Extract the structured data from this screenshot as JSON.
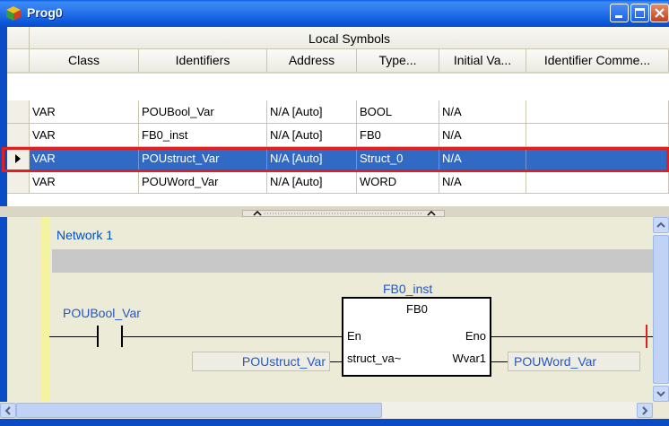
{
  "window": {
    "title": "Prog0"
  },
  "symbols": {
    "group_header": "Local Symbols",
    "columns": [
      "Class",
      "Identifiers",
      "Address",
      "Type...",
      "Initial Va...",
      "Identifier Comme..."
    ],
    "rows": [
      {
        "cells": [
          "VAR",
          "POUBool_Var",
          "N/A [Auto]",
          "BOOL",
          "N/A",
          ""
        ],
        "selected": false
      },
      {
        "cells": [
          "VAR",
          "FB0_inst",
          "N/A [Auto]",
          "FB0",
          "N/A",
          ""
        ],
        "selected": false
      },
      {
        "cells": [
          "VAR",
          "POUstruct_Var",
          "N/A [Auto]",
          "Struct_0",
          "N/A",
          ""
        ],
        "selected": true
      },
      {
        "cells": [
          "VAR",
          "POUWord_Var",
          "N/A [Auto]",
          "WORD",
          "N/A",
          ""
        ],
        "selected": false
      }
    ]
  },
  "ladder": {
    "network_label": "Network 1",
    "contact_label": "POUBool_Var",
    "fb_instance": "FB0_inst",
    "fb_type": "FB0",
    "fb_in_en": "En",
    "fb_out_eno": "Eno",
    "fb_in_pin": "struct_va~",
    "fb_out_pin": "Wvar1",
    "input_var": "POUstruct_Var",
    "output_var": "POUWord_Var"
  },
  "colors": {
    "selection": "#316ac5",
    "highlight_border": "#e02020",
    "variable_text": "#2456c8",
    "rail": "#f3f3a0"
  }
}
